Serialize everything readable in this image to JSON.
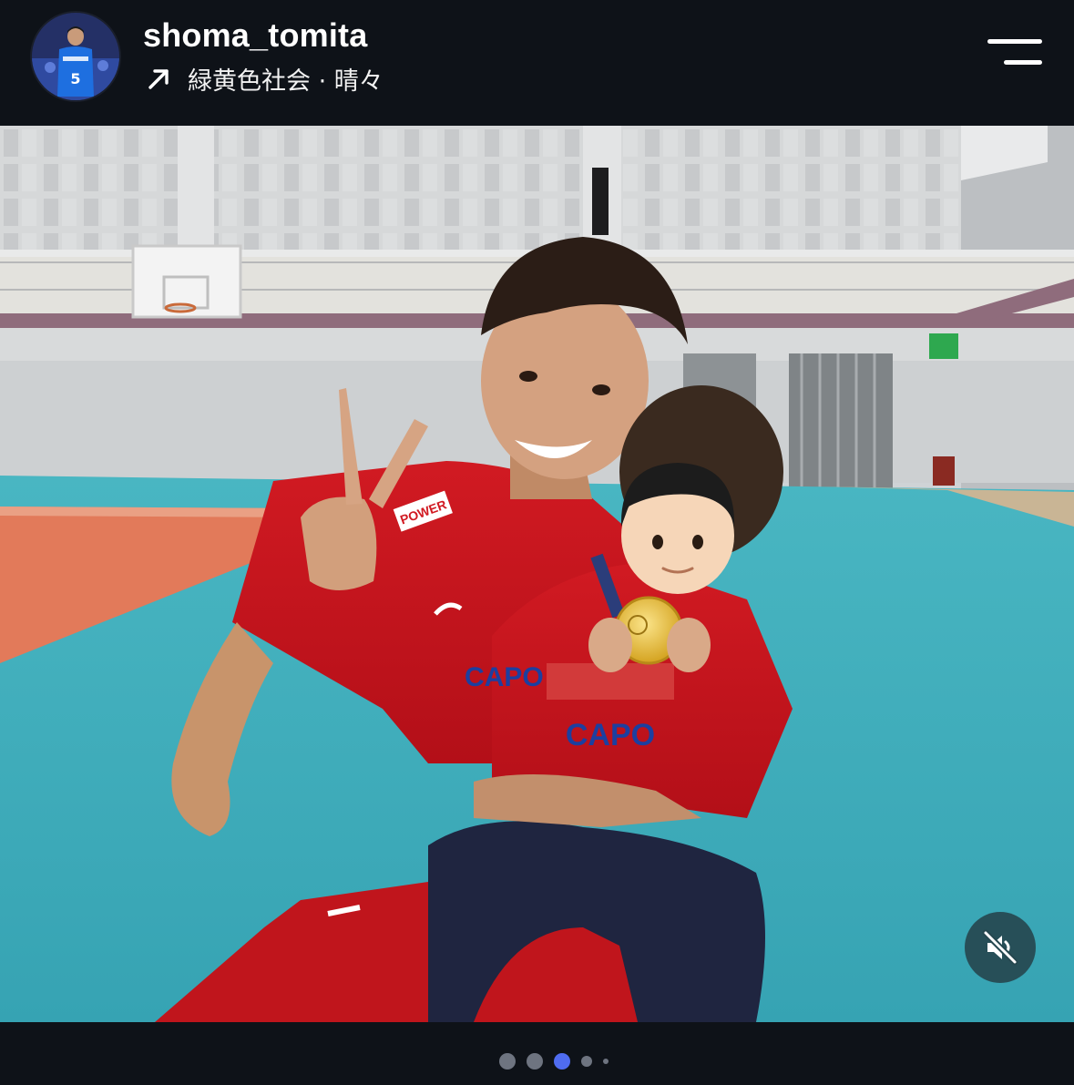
{
  "post": {
    "username": "shoma_tomita",
    "music": "緑黄色社会 · 晴々"
  },
  "icons": {
    "arrow": "arrow-up-right-icon",
    "menu": "menu-icon",
    "mute": "speaker-muted-icon"
  },
  "carousel": {
    "total": 5,
    "current_index": 2
  },
  "colors": {
    "background": "#0e1218",
    "active_dot": "#4f6cf0",
    "inactive_dot": "#6e7480",
    "mute_button": "#264850"
  }
}
